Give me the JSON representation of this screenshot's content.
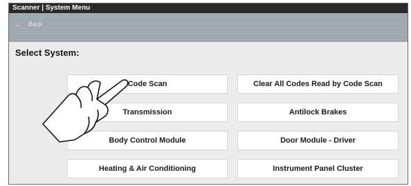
{
  "titlebar": {
    "title": "Scanner | System Menu"
  },
  "nav": {
    "back_label": "Back",
    "back_icon": "left-arrow-icon"
  },
  "main": {
    "heading": "Select System:",
    "systems": [
      "Code Scan",
      "Clear All Codes Read by Code Scan",
      "Transmission",
      "Antilock Brakes",
      "Body Control Module",
      "Door Module - Driver",
      "Heating & Air Conditioning",
      "Instrument Panel Cluster"
    ]
  },
  "overlay": {
    "icon": "pointing-hand-icon"
  }
}
